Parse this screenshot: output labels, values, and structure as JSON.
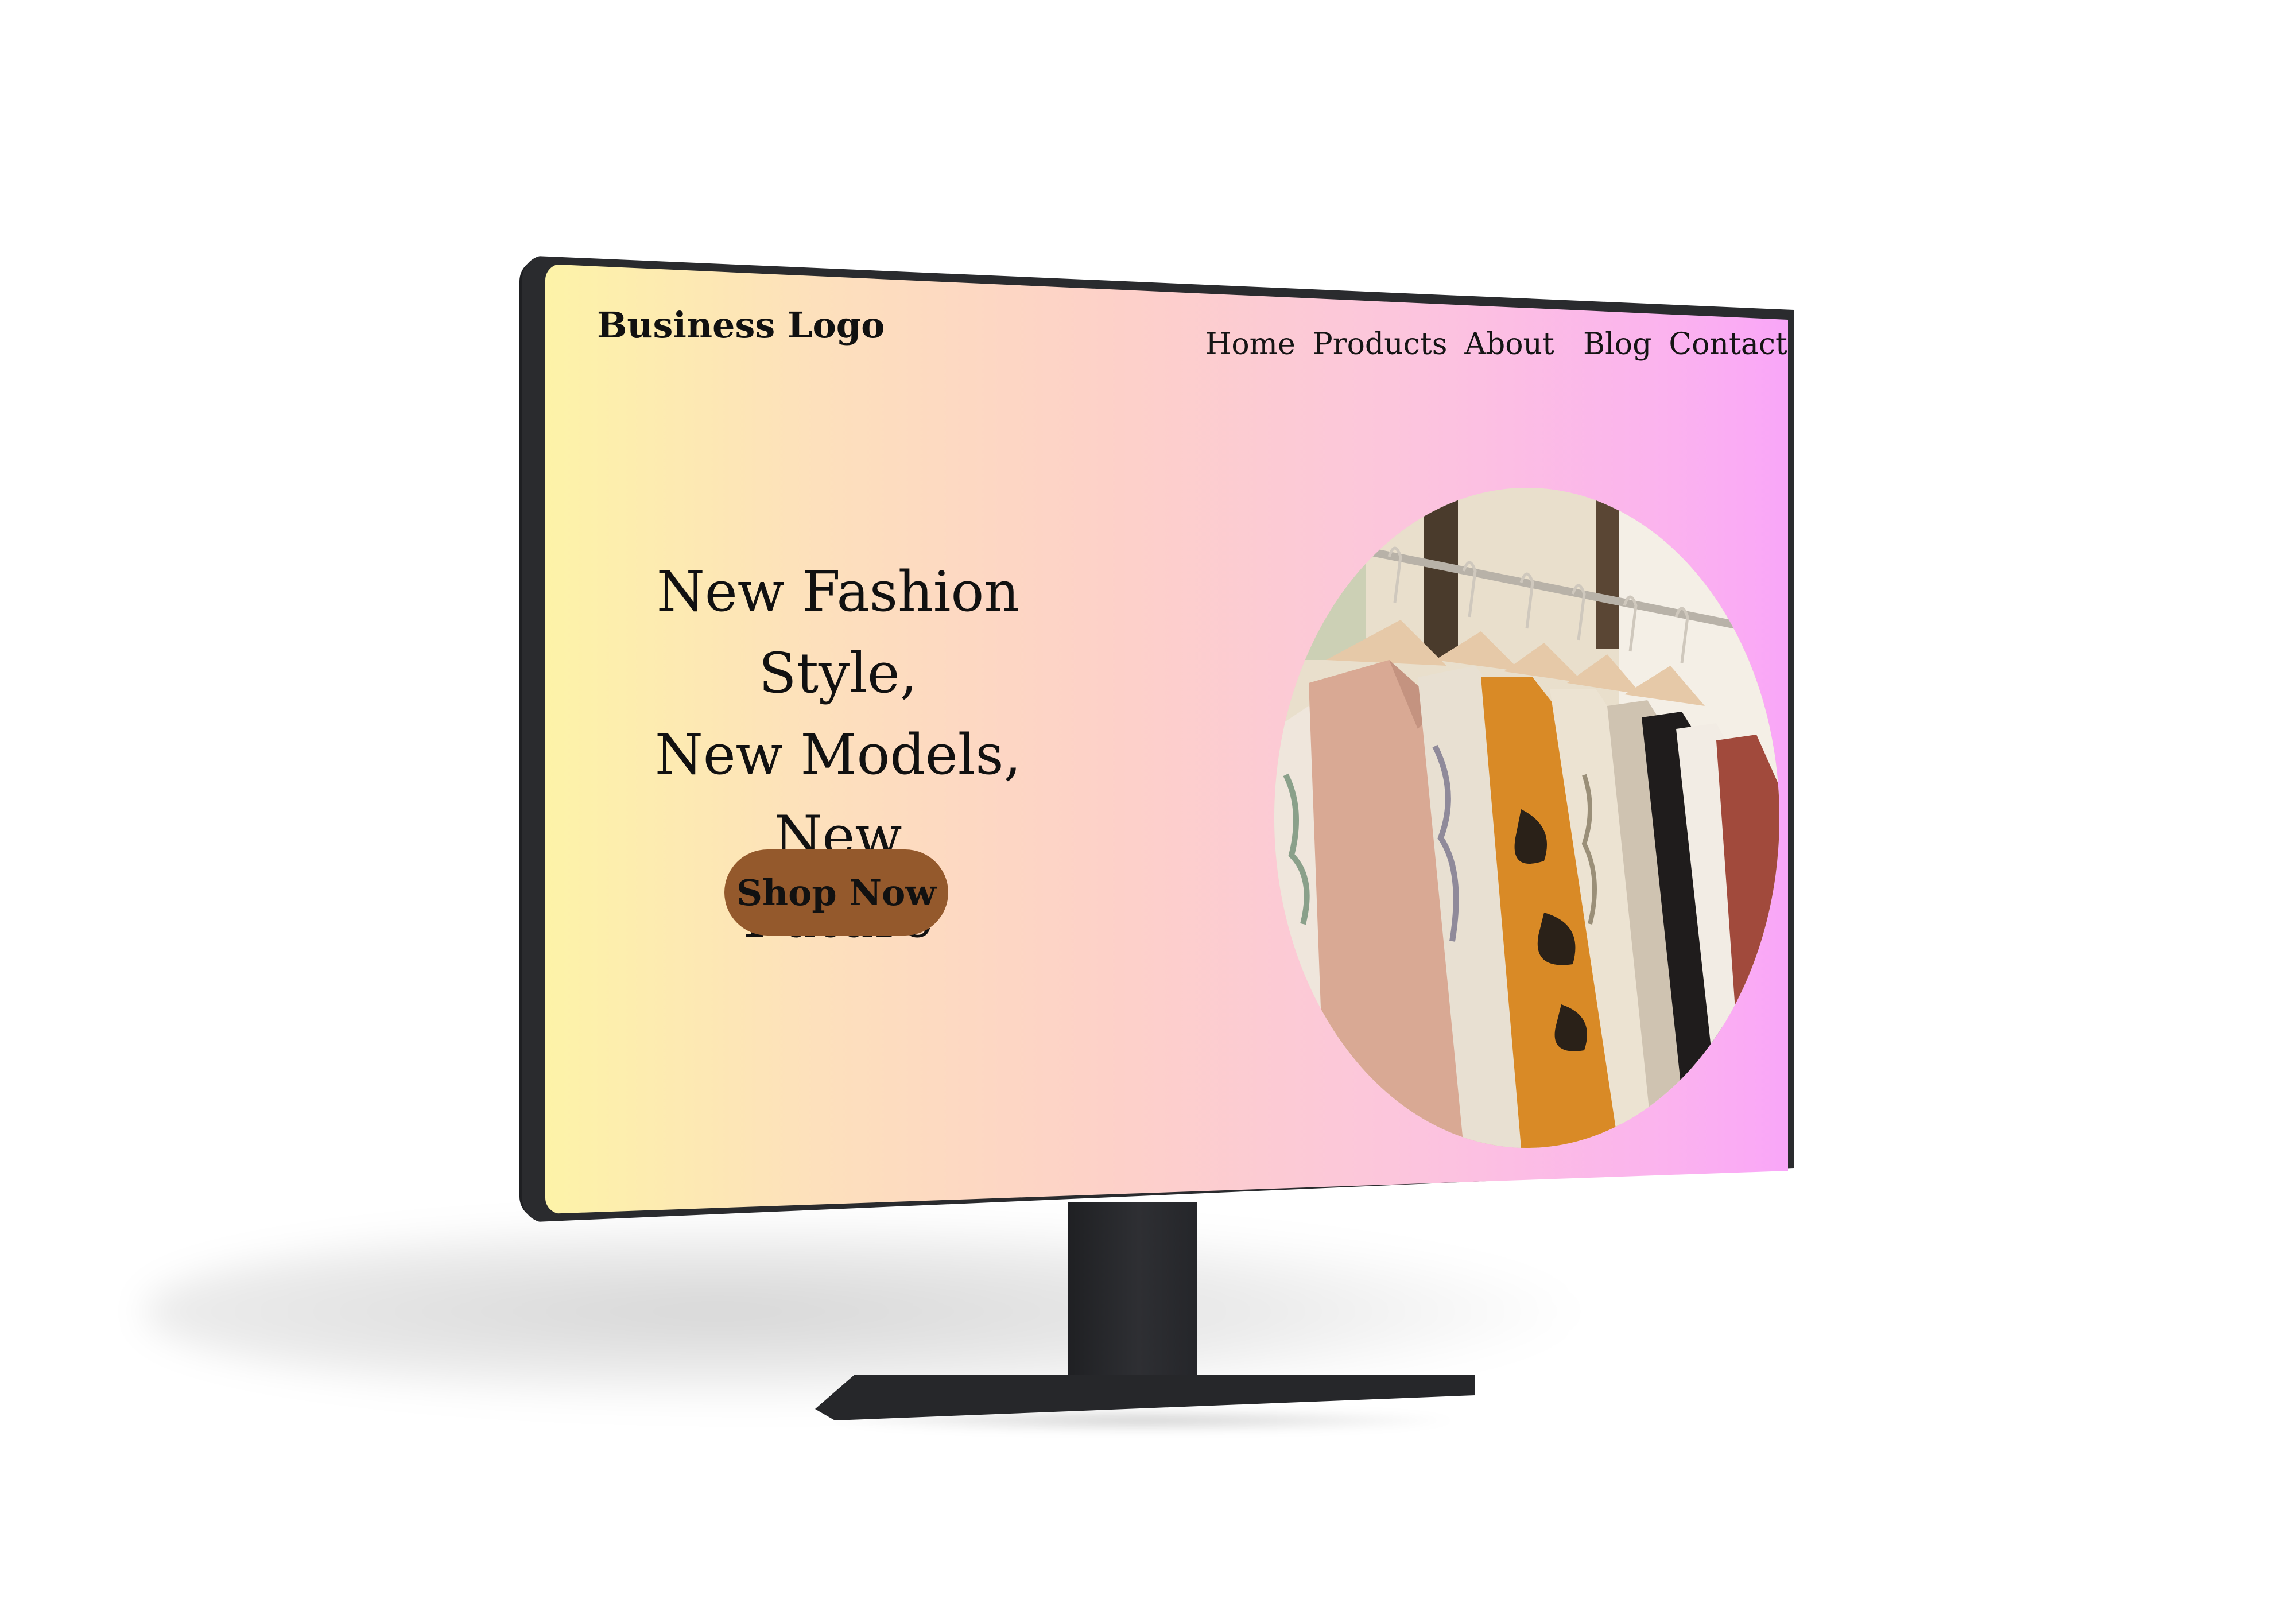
{
  "site": {
    "logo": "Business Logo",
    "nav": {
      "home": "Home",
      "products": "Products",
      "about": "About",
      "blog": "Blog",
      "contact": "Contact"
    },
    "hero": {
      "line1": "New Fashion Style,",
      "line2": "New Models, New",
      "line3": "Future",
      "cta": "Shop Now"
    },
    "hero_image": "clothing-rack-photo"
  },
  "colors": {
    "gradient_start": "#fdf3a8",
    "gradient_end": "#f9a6f8",
    "cta_background": "#94592c",
    "device_frame": "#2a2b2e"
  }
}
